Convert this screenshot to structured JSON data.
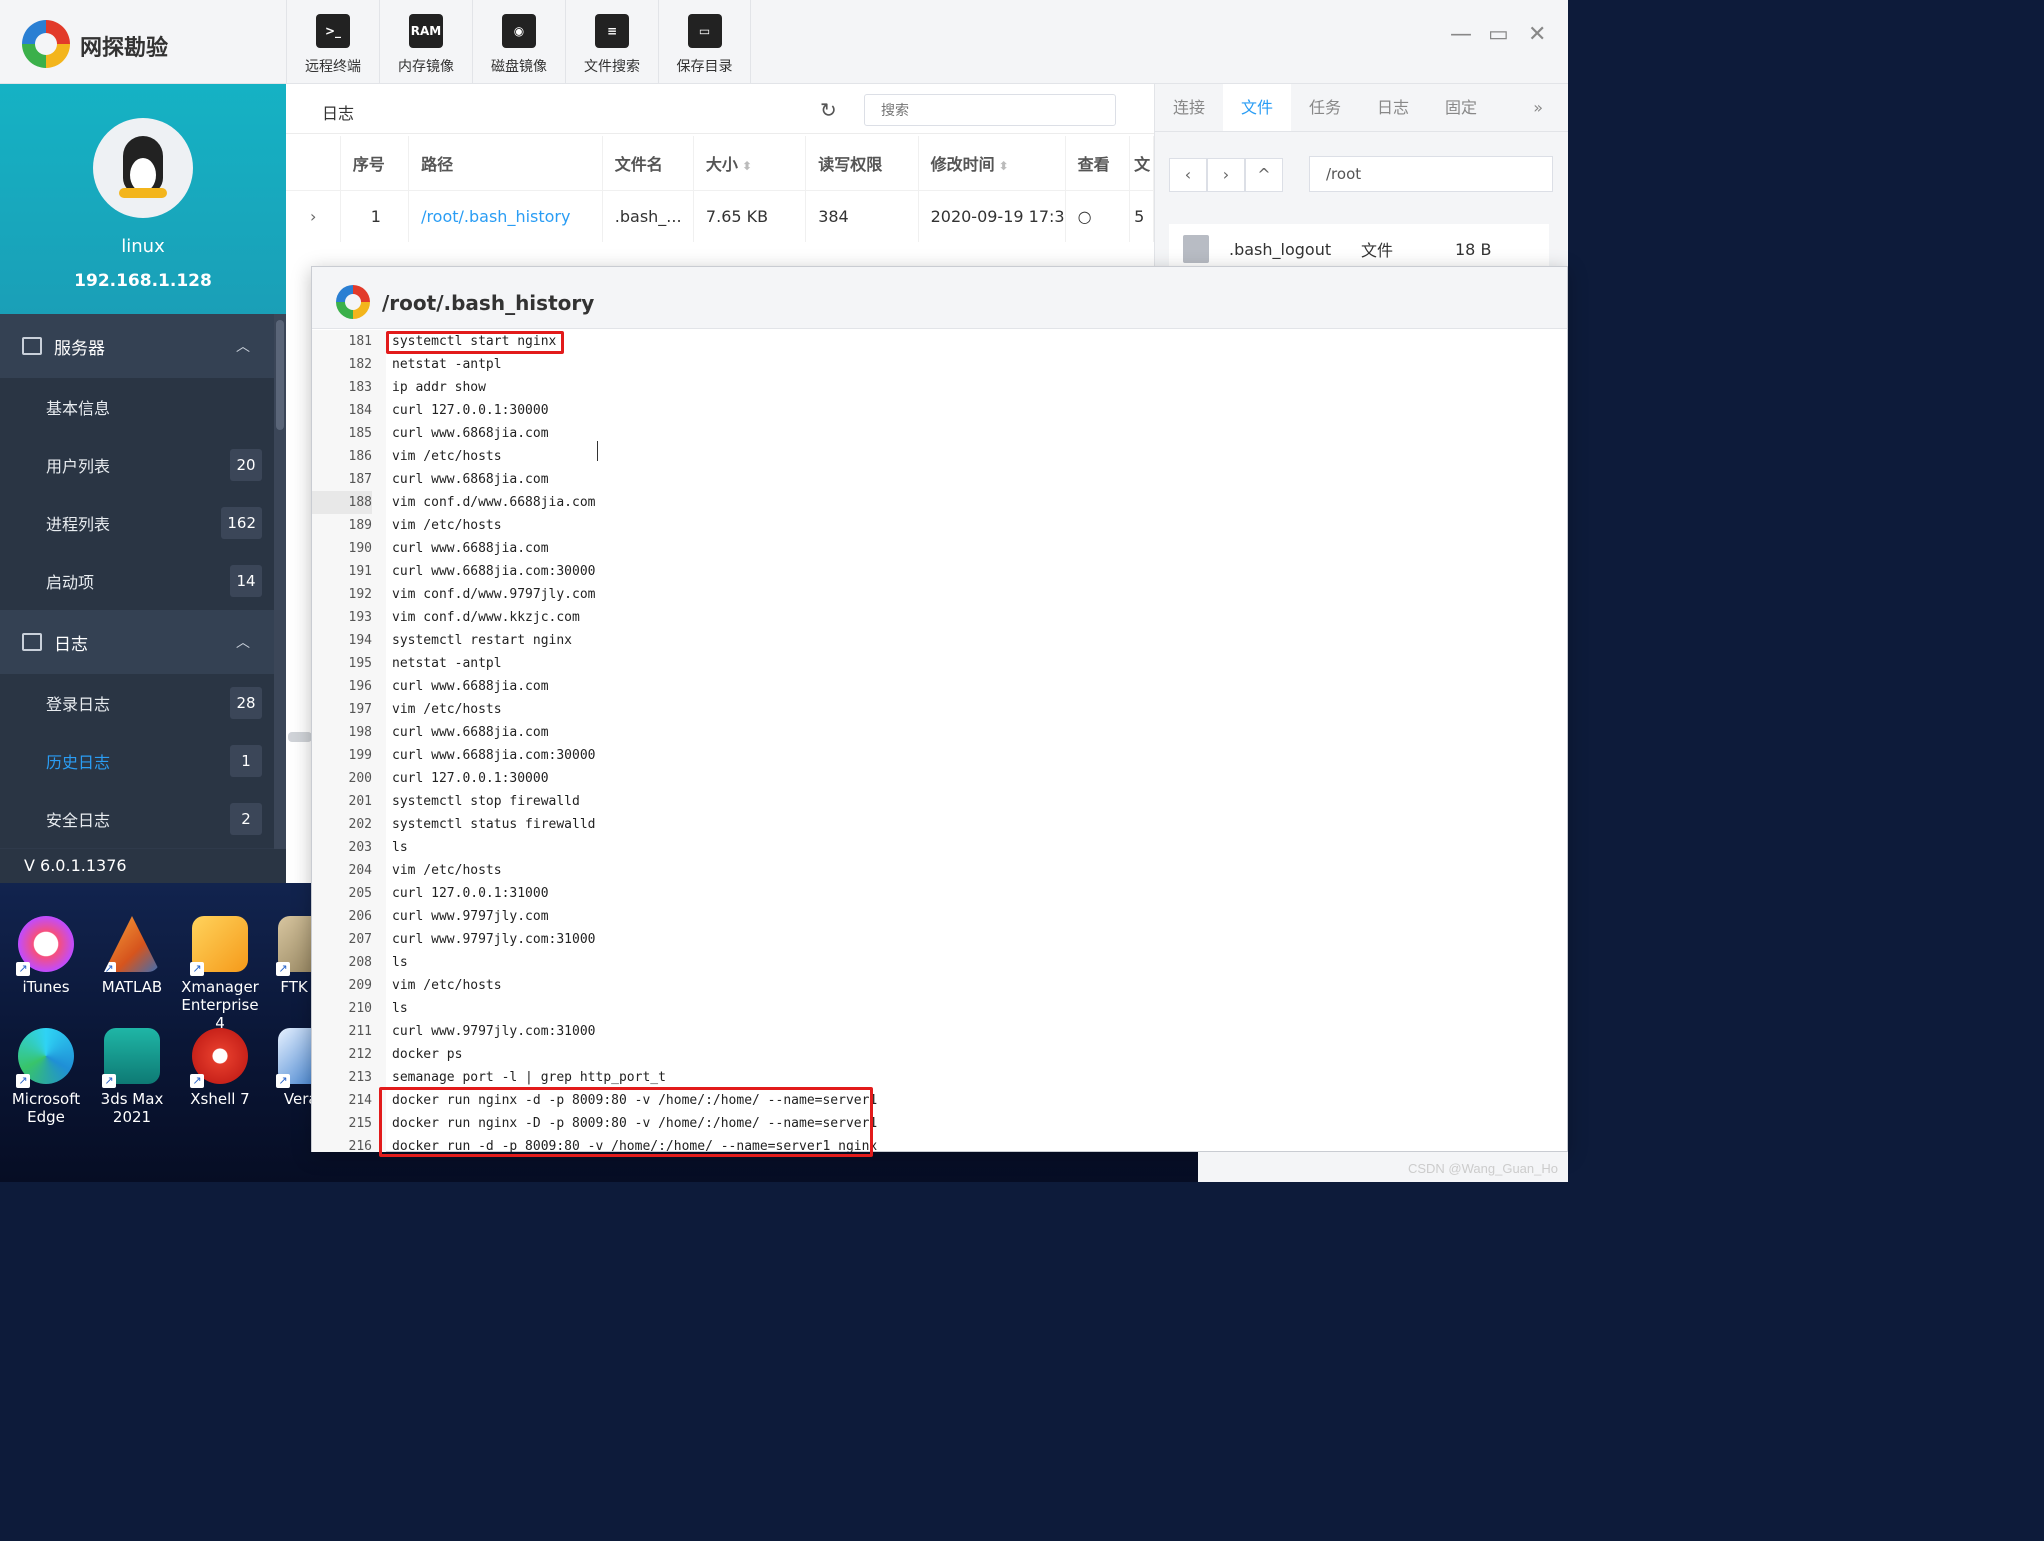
{
  "app": {
    "title": "网探勘验"
  },
  "toolbar": [
    {
      "label": "远程终端",
      "icon": "terminal-icon",
      "glyph": ">_"
    },
    {
      "label": "内存镜像",
      "icon": "ram-icon",
      "glyph": "RAM"
    },
    {
      "label": "磁盘镜像",
      "icon": "disk-icon",
      "glyph": "◉"
    },
    {
      "label": "文件搜索",
      "icon": "file-search-icon",
      "glyph": "≡"
    },
    {
      "label": "保存目录",
      "icon": "folder-icon",
      "glyph": "▭"
    }
  ],
  "window_controls": {
    "min": "—",
    "max": "▭",
    "close": "✕"
  },
  "profile": {
    "hostname": "linux",
    "ip": "192.168.1.128"
  },
  "sidebar": {
    "groups": [
      {
        "label": "服务器",
        "chevron": "︿",
        "items": [
          {
            "label": "基本信息",
            "badge": ""
          },
          {
            "label": "用户列表",
            "badge": "20"
          },
          {
            "label": "进程列表",
            "badge": "162"
          },
          {
            "label": "启动项",
            "badge": "14"
          }
        ]
      },
      {
        "label": "日志",
        "chevron": "︿",
        "items": [
          {
            "label": "登录日志",
            "badge": "28"
          },
          {
            "label": "历史日志",
            "badge": "1",
            "active": true
          },
          {
            "label": "安全日志",
            "badge": "2"
          }
        ]
      }
    ],
    "version": "V 6.0.1.1376"
  },
  "log_panel": {
    "title": "日志",
    "search_placeholder": "搜索",
    "columns": [
      "序号",
      "路径",
      "文件名",
      "大小",
      "读写权限",
      "修改时间",
      "查看",
      "文"
    ],
    "row": {
      "expand": "›",
      "index": "1",
      "path": "/root/.bash_history",
      "filename": ".bash_...",
      "size": "7.65 KB",
      "perm": "384",
      "mtime": "2020-09-19 17:3",
      "view": "○",
      "extra": "5"
    }
  },
  "right_panel": {
    "tabs": [
      "连接",
      "文件",
      "任务",
      "日志",
      "固定"
    ],
    "active_tab": 1,
    "more": "»",
    "nav": {
      "back": "‹",
      "forward": "›",
      "up": "^"
    },
    "path": "/root",
    "file": {
      "name": ".bash_logout",
      "type": "文件",
      "size": "18 B"
    }
  },
  "editor": {
    "title": "/root/.bash_history",
    "lines": [
      {
        "n": "181",
        "code": "systemctl start nginx"
      },
      {
        "n": "182",
        "code": "netstat -antpl"
      },
      {
        "n": "183",
        "code": "ip addr show"
      },
      {
        "n": "184",
        "code": "curl 127.0.0.1:30000"
      },
      {
        "n": "185",
        "code": "curl www.6868jia.com"
      },
      {
        "n": "186",
        "code": "vim /etc/hosts"
      },
      {
        "n": "187",
        "code": "curl www.6868jia.com"
      },
      {
        "n": "188",
        "code": "vim conf.d/www.6688jia.com"
      },
      {
        "n": "189",
        "code": "vim /etc/hosts"
      },
      {
        "n": "190",
        "code": "curl www.6688jia.com"
      },
      {
        "n": "191",
        "code": "curl www.6688jia.com:30000"
      },
      {
        "n": "192",
        "code": "vim conf.d/www.9797jly.com"
      },
      {
        "n": "193",
        "code": "vim conf.d/www.kkzjc.com"
      },
      {
        "n": "194",
        "code": "systemctl restart nginx"
      },
      {
        "n": "195",
        "code": "netstat -antpl"
      },
      {
        "n": "196",
        "code": "curl www.6688jia.com"
      },
      {
        "n": "197",
        "code": "vim /etc/hosts"
      },
      {
        "n": "198",
        "code": "curl www.6688jia.com"
      },
      {
        "n": "199",
        "code": "curl www.6688jia.com:30000"
      },
      {
        "n": "200",
        "code": "curl 127.0.0.1:30000"
      },
      {
        "n": "201",
        "code": "systemctl stop firewalld"
      },
      {
        "n": "202",
        "code": "systemctl status firewalld"
      },
      {
        "n": "203",
        "code": "ls"
      },
      {
        "n": "204",
        "code": "vim /etc/hosts"
      },
      {
        "n": "205",
        "code": "curl 127.0.0.1:31000"
      },
      {
        "n": "206",
        "code": "curl www.9797jly.com"
      },
      {
        "n": "207",
        "code": "curl www.9797jly.com:31000"
      },
      {
        "n": "208",
        "code": "ls"
      },
      {
        "n": "209",
        "code": "vim /etc/hosts"
      },
      {
        "n": "210",
        "code": "ls"
      },
      {
        "n": "211",
        "code": "curl www.9797jly.com:31000"
      },
      {
        "n": "212",
        "code": "docker ps"
      },
      {
        "n": "213",
        "code": "semanage port -l | grep http_port_t"
      },
      {
        "n": "214",
        "code": "docker run nginx -d -p 8009:80 -v /home/:/home/ --name=server1"
      },
      {
        "n": "215",
        "code": "docker run nginx -D -p 8009:80 -v /home/:/home/ --name=server1"
      },
      {
        "n": "216",
        "code": "docker run -d -p 8009:80 -v /home/:/home/ --name=server1 nginx"
      }
    ]
  },
  "desktop": {
    "icons": [
      {
        "label": "iTunes",
        "cls": "itunes",
        "name": "itunes-icon"
      },
      {
        "label": "MATLAB",
        "cls": "matlab",
        "name": "matlab-icon"
      },
      {
        "label": "Xmanager Enterprise 4",
        "cls": "xmanager",
        "name": "xmanager-icon"
      },
      {
        "label": "FTK Im",
        "cls": "ftk",
        "name": "ftk-icon"
      },
      {
        "label": "Microsoft Edge",
        "cls": "edge",
        "name": "edge-icon"
      },
      {
        "label": "3ds Max 2021",
        "cls": "max3d",
        "name": "3dsmax-icon"
      },
      {
        "label": "Xshell 7",
        "cls": "xshell",
        "name": "xshell-icon"
      },
      {
        "label": "VeraC",
        "cls": "vera",
        "name": "veracrypt-icon"
      }
    ]
  },
  "watermark": "CSDN @Wang_Guan_Ho"
}
